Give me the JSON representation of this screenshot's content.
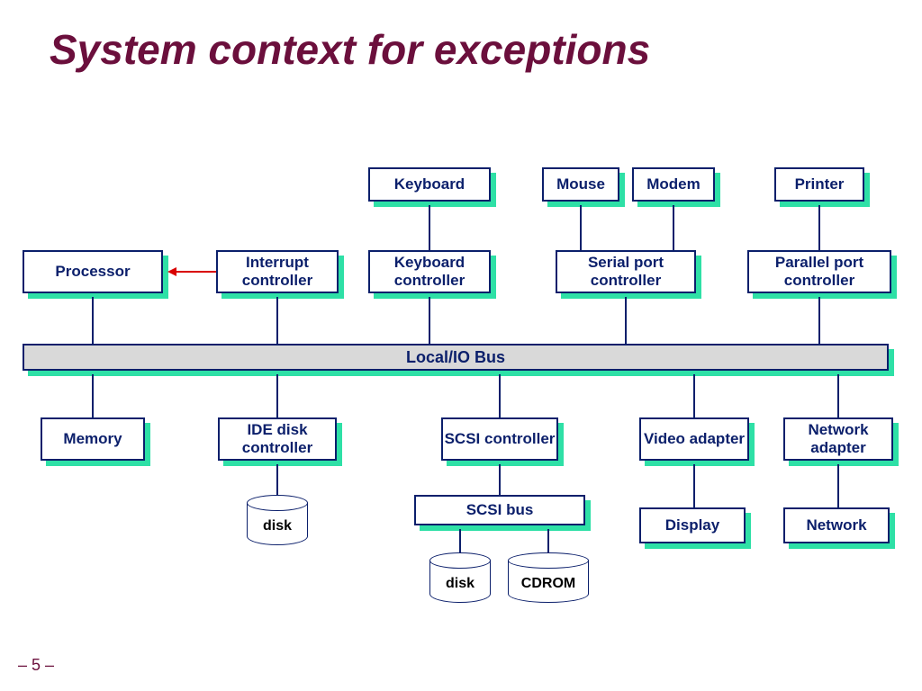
{
  "title": "System context for exceptions",
  "footer": "– 5 –",
  "nodes": {
    "keyboard": "Keyboard",
    "mouse": "Mouse",
    "modem": "Modem",
    "printer": "Printer",
    "processor": "Processor",
    "interrupt_ctrl": "Interrupt controller",
    "keyboard_ctrl": "Keyboard controller",
    "serial_ctrl": "Serial port controller",
    "parallel_ctrl": "Parallel port controller",
    "bus": "Local/IO Bus",
    "memory": "Memory",
    "ide_ctrl": "IDE disk controller",
    "scsi_ctrl": "SCSI controller",
    "video": "Video adapter",
    "net_adapter": "Network adapter",
    "scsi_bus": "SCSI bus",
    "display": "Display",
    "network": "Network"
  },
  "cylinders": {
    "disk1": "disk",
    "disk2": "disk",
    "cdrom": "CDROM"
  }
}
